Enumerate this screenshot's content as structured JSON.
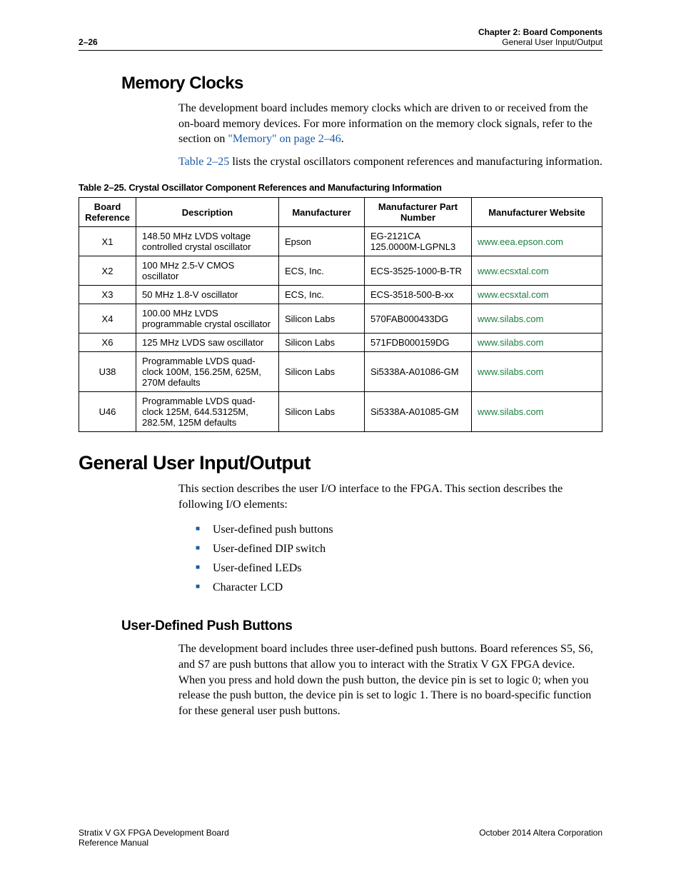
{
  "header": {
    "page_num": "2–26",
    "chapter": "Chapter 2:  Board Components",
    "section": "General User Input/Output"
  },
  "memory_clocks": {
    "heading": "Memory Clocks",
    "para1_before": "The development board includes memory clocks which are driven to or received from the on-board memory devices. For more information on the memory clock signals, refer to the section on ",
    "para1_link": "\"Memory\" on page 2–46",
    "para1_after": ".",
    "para2_before": "",
    "para2_link": "Table 2–25",
    "para2_after": " lists the crystal oscillators component references and manufacturing information."
  },
  "table": {
    "caption": "Table 2–25.  Crystal Oscillator Component References and Manufacturing Information",
    "headers": {
      "ref": "Board Reference",
      "desc": "Description",
      "mfr": "Manufacturer",
      "part": "Manufacturer Part Number",
      "web": "Manufacturer Website"
    },
    "rows": [
      {
        "ref": "X1",
        "desc": "148.50 MHz LVDS voltage controlled crystal oscillator",
        "mfr": "Epson",
        "part": "EG-2121CA 125.0000M-LGPNL3",
        "web": "www.eea.epson.com"
      },
      {
        "ref": "X2",
        "desc": "100 MHz 2.5-V CMOS oscillator",
        "mfr": "ECS, Inc.",
        "part": "ECS-3525-1000-B-TR",
        "web": "www.ecsxtal.com"
      },
      {
        "ref": "X3",
        "desc": "50 MHz 1.8-V oscillator",
        "mfr": "ECS, Inc.",
        "part": "ECS-3518-500-B-xx",
        "web": "www.ecsxtal.com"
      },
      {
        "ref": "X4",
        "desc": "100.00 MHz LVDS programmable crystal oscillator",
        "mfr": "Silicon Labs",
        "part": "570FAB000433DG",
        "web": "www.silabs.com"
      },
      {
        "ref": "X6",
        "desc": "125 MHz LVDS saw oscillator",
        "mfr": "Silicon Labs",
        "part": "571FDB000159DG",
        "web": "www.silabs.com"
      },
      {
        "ref": "U38",
        "desc": "Programmable LVDS quad-clock 100M, 156.25M, 625M, 270M defaults",
        "mfr": "Silicon Labs",
        "part": "Si5338A-A01086-GM",
        "web": "www.silabs.com"
      },
      {
        "ref": "U46",
        "desc": "Programmable LVDS quad-clock 125M, 644.53125M, 282.5M, 125M defaults",
        "mfr": "Silicon Labs",
        "part": "Si5338A-A01085-GM",
        "web": "www.silabs.com"
      }
    ]
  },
  "general_io": {
    "heading": "General User Input/Output",
    "intro": "This section describes the user I/O interface to the FPGA. This section describes the following I/O elements:",
    "bullets": [
      "User-defined push buttons",
      "User-defined DIP switch",
      "User-defined LEDs",
      "Character LCD"
    ]
  },
  "push_buttons": {
    "heading": "User-Defined Push Buttons",
    "para": "The development board includes three user-defined push buttons. Board references S5, S6, and S7 are push buttons that allow you to interact with the Stratix V GX FPGA device. When you press and hold down the push button, the device pin is set to logic 0; when you release the push button, the device pin is set to logic 1. There is no board-specific function for these general user push buttons."
  },
  "footer": {
    "left1": "Stratix V GX FPGA Development Board",
    "left2": "Reference Manual",
    "right": "October 2014   Altera Corporation"
  }
}
